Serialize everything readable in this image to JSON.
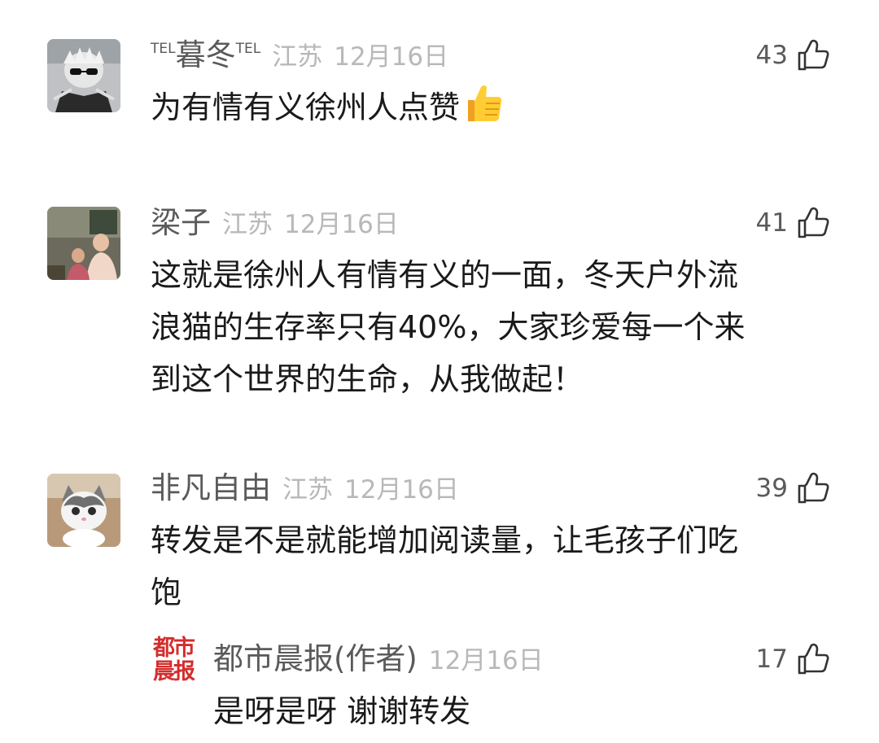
{
  "comments": [
    {
      "user_prefix": "TEL",
      "user_name": "暮冬",
      "user_suffix": "TEL",
      "location": "江苏",
      "date": "12月16日",
      "likes": "43",
      "text": "为有情有义徐州人点赞",
      "emoji": "thumbs-up-emoji",
      "avatar": "anime-character-avatar"
    },
    {
      "user_name": "梁子",
      "location": "江苏",
      "date": "12月16日",
      "likes": "41",
      "text_lines": [
        "这就是徐州人有情有义的一面，冬天户外流",
        "浪猫的生存率只有40%，大家珍爱每一个来",
        "到这个世界的生命，从我做起！"
      ],
      "avatar": "family-photo-avatar"
    },
    {
      "user_name": "非凡自由",
      "location": "江苏",
      "date": "12月16日",
      "likes": "39",
      "text_lines": [
        "转发是不是就能增加阅读量，让毛孩子们吃",
        "饱"
      ],
      "avatar": "cat-photo-avatar"
    }
  ],
  "reply": {
    "logo_text_top": "都市",
    "logo_text_bottom": "晨报",
    "user_name": "都市晨报(作者)",
    "date": "12月16日",
    "likes": "17",
    "text": "是呀是呀 谢谢转发"
  },
  "colors": {
    "name": "#5a5a5a",
    "meta": "#b8b8b8",
    "body_text": "#1a1a1a",
    "logo_red": "#d42d2d"
  },
  "icons": {
    "like": "thumbs-up-icon"
  }
}
